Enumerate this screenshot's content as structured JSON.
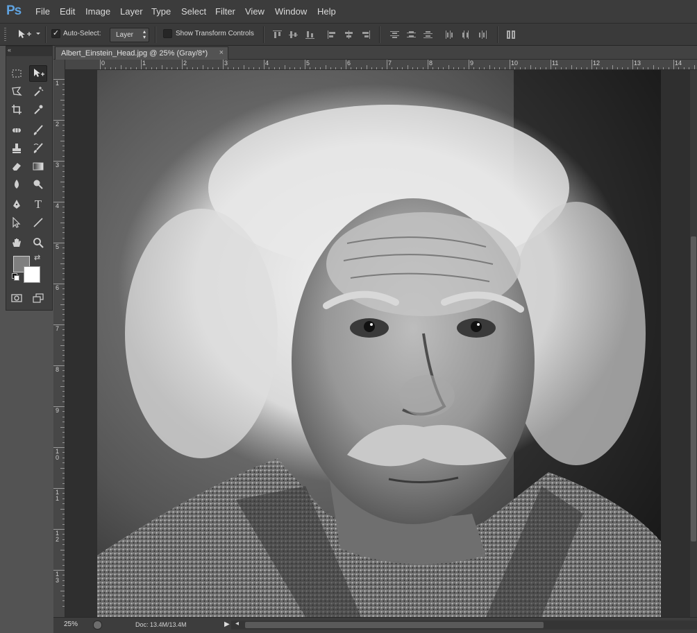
{
  "app": {
    "logo": "Ps"
  },
  "menu": [
    "File",
    "Edit",
    "Image",
    "Layer",
    "Type",
    "Select",
    "Filter",
    "View",
    "Window",
    "Help"
  ],
  "options": {
    "auto_select_label": "Auto-Select:",
    "auto_select_checked": true,
    "layer_value": "Layer",
    "transform_label": "Show Transform Controls",
    "transform_checked": false
  },
  "document": {
    "tab_title": "Albert_Einstein_Head.jpg @ 25% (Gray/8*)",
    "close": "×"
  },
  "ruler_top": [
    "0",
    "1",
    "2",
    "3",
    "4",
    "5",
    "6",
    "7",
    "8",
    "9",
    "10",
    "11",
    "12",
    "13",
    "14"
  ],
  "ruler_left": [
    "1",
    "2",
    "3",
    "4",
    "5",
    "6",
    "7",
    "8",
    "9",
    "1\n0",
    "1\n1",
    "1\n2",
    "1\n3"
  ],
  "status": {
    "zoom": "25%",
    "doc": "Doc: 13.4M/13.4M"
  },
  "colors": {
    "foreground": "#7f7f7f",
    "background": "#ffffff",
    "accent": "#5fa3e0"
  },
  "toolbox_icons": [
    "rectangular-marquee-icon",
    "move-icon",
    "polygonal-lasso-icon",
    "magic-wand-icon",
    "crop-icon",
    "eyedropper-icon",
    "spot-healing-icon",
    "brush-icon",
    "clone-stamp-icon",
    "history-brush-icon",
    "eraser-icon",
    "gradient-icon",
    "blur-icon",
    "dodge-icon",
    "pen-icon",
    "type-icon",
    "path-selection-icon",
    "line-icon",
    "hand-icon",
    "zoom-icon",
    "quick-mask-icon",
    "screen-mode-icon"
  ]
}
